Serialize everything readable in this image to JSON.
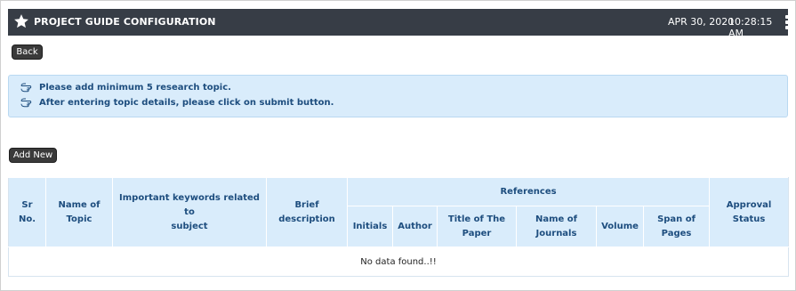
{
  "header": {
    "title": "PROJECT GUIDE CONFIGURATION",
    "date": "APR 30, 2020",
    "time": "10:28:15 AM"
  },
  "buttons": {
    "back": "Back",
    "add_new": "Add New"
  },
  "info": {
    "line1": "Please add minimum 5 research topic.",
    "line2": "After entering topic details, please click on submit button."
  },
  "table": {
    "headers": {
      "sr_no_1": "Sr",
      "sr_no_2": "No.",
      "name_1": "Name of",
      "name_2": "Topic",
      "keywords_1": "Important keywords related to",
      "keywords_2": "subject",
      "brief_1": "Brief",
      "brief_2": "description",
      "references": "References",
      "approval_1": "Approval",
      "approval_2": "Status",
      "initials": "Initials",
      "author": "Author",
      "paper_title_1": "Title of The",
      "paper_title_2": "Paper",
      "journals_1": "Name of",
      "journals_2": "Journals",
      "volume": "Volume",
      "pages_1": "Span of",
      "pages_2": "Pages"
    },
    "empty_message": "No data found..!!"
  }
}
